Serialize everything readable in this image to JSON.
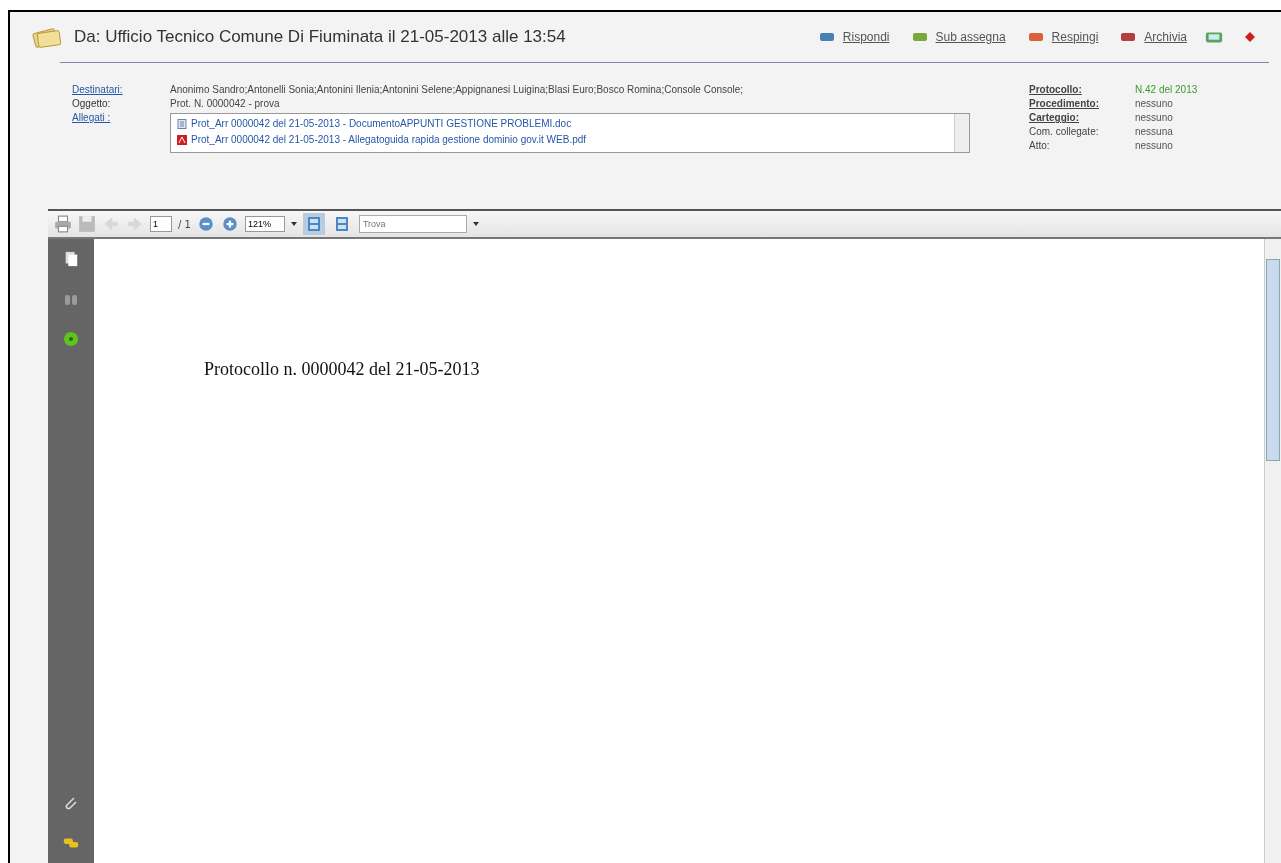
{
  "header": {
    "title": "Da: Ufficio Tecnico Comune Di Fiuminata il 21-05-2013 alle 13:54",
    "actions": [
      {
        "label": "Rispondi",
        "kind": "reply"
      },
      {
        "label": "Sub assegna",
        "kind": "assign"
      },
      {
        "label": "Respingi",
        "kind": "reject"
      },
      {
        "label": "Archivia",
        "kind": "archive"
      }
    ]
  },
  "details": [
    {
      "label": "Destinatari:",
      "link": true,
      "value": "Anonimo Sandro;Antonelli Sonia;Antonini Ilenia;Antonini Selene;Appignanesi Luigina;Blasi Euro;Bosco Romina;Console Console;"
    },
    {
      "label": "Oggetto:",
      "link": false,
      "value": "Prot. N. 0000042 - prova"
    }
  ],
  "attachments": {
    "label": "Allegati :",
    "files": [
      {
        "name": "Prot_Arr 0000042 del 21-05-2013 - DocumentoAPPUNTI GESTIONE PROBLEMI.doc",
        "kind": "doc"
      },
      {
        "name": "Prot_Arr 0000042 del 21-05-2013 - Allegatoguida rapida gestione dominio gov.it WEB.pdf",
        "kind": "pdf"
      }
    ]
  },
  "registry": [
    {
      "label": "Protocollo:",
      "link": true,
      "value": "N.42 del 2013",
      "highlight": true
    },
    {
      "label": "Procedimento:",
      "link": true,
      "value": "nessuno",
      "highlight": false
    },
    {
      "label": "Carteggio:",
      "link": true,
      "value": "nessuno",
      "highlight": false
    },
    {
      "label": "Com. collegate:",
      "link": false,
      "value": "nessuna",
      "highlight": false
    },
    {
      "label": "Atto:",
      "link": false,
      "value": "nessuno",
      "highlight": false
    }
  ],
  "viewer": {
    "page": "1",
    "page_count": "/ 1",
    "zoom": "121%",
    "find": {
      "placeholder": "Trova"
    },
    "view_modes": [
      {
        "selected": true
      },
      {
        "selected": false
      }
    ],
    "document_text": "Protocollo n. 0000042 del 21-05-2013"
  }
}
